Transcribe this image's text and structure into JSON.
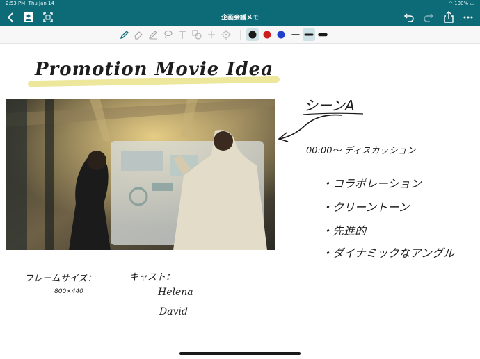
{
  "status": {
    "time": "2:53 PM",
    "date": "Thu Jan 14",
    "battery": "100%"
  },
  "app": {
    "title": "企画会議メモ"
  },
  "icons": {
    "back": "chevron-left-icon",
    "contacts": "person-card-icon",
    "fit": "fit-frame-icon",
    "undo": "undo-icon",
    "redo": "redo-icon",
    "share": "share-icon",
    "more": "ellipsis-icon"
  },
  "tools": [
    "pen-tool",
    "eraser-tool",
    "pencil-tool",
    "lasso-tool",
    "text-tool",
    "shape-tool",
    "plus-tool",
    "target-tool"
  ],
  "colors": {
    "black": "#1a1a1a",
    "red": "#cc1f1f",
    "blue": "#1f3fcc",
    "accent": "#0d6a77",
    "highlight": "#ece79a"
  },
  "note": {
    "title": "Promotion Movie Idea",
    "scene": "シーンA",
    "time": "00:00～ ディスカッション",
    "bullets": [
      "・コラボレーション",
      "・クリーントーン",
      "・先進的",
      "・ダイナミックなアングル"
    ],
    "frame_label": "フレームサイズ：",
    "frame_size": "800×440",
    "cast_label": "キャスト：",
    "cast": [
      "Helena",
      "David"
    ]
  }
}
